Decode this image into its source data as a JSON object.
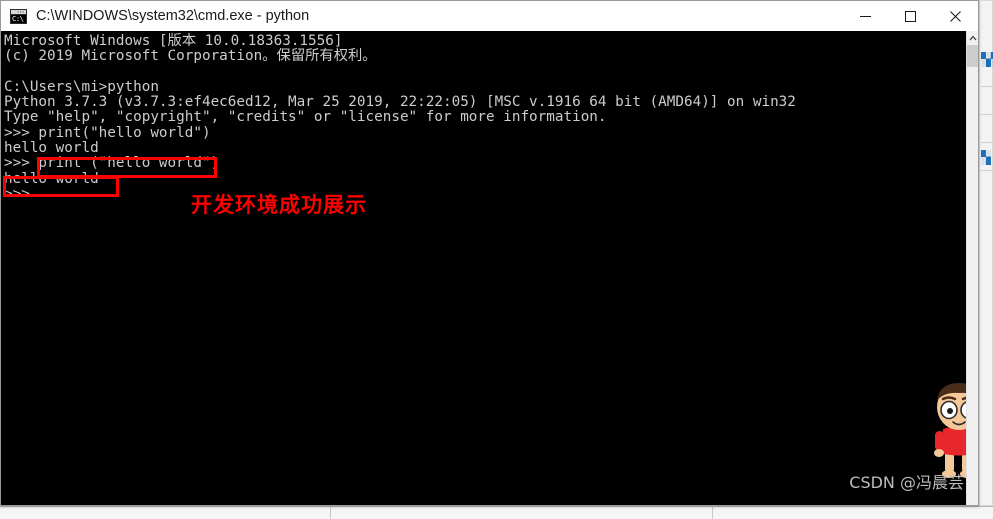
{
  "window": {
    "title": "C:\\WINDOWS\\system32\\cmd.exe - python",
    "icon_name": "cmd-exe-icon",
    "icon_text": "C:\\",
    "controls": {
      "minimize_label": "Minimize",
      "maximize_label": "Maximize",
      "close_label": "Close"
    }
  },
  "console": {
    "background_color": "#000000",
    "text_color": "#cccccc",
    "lines": [
      "Microsoft Windows [版本 10.0.18363.1556]",
      "(c) 2019 Microsoft Corporation。保留所有权利。",
      "",
      "C:\\Users\\mi>python",
      "Python 3.7.3 (v3.7.3:ef4ec6ed12, Mar 25 2019, 22:22:05) [MSC v.1916 64 bit (AMD64)] on win32",
      "Type \"help\", \"copyright\", \"credits\" or \"license\" for more information.",
      ">>> print(\"hello world\")",
      "hello world",
      ">>> print (\"hello world\")",
      "hello world",
      ">>> "
    ]
  },
  "scrollbar": {
    "up_arrow_name": "scroll-up-arrow",
    "thumb_name": "scroll-thumb"
  },
  "annotations": {
    "highlight_color": "#fd0000",
    "boxes": [
      {
        "name": "highlight-box-print-command",
        "label": "print (\"hello world\")"
      },
      {
        "name": "highlight-box-output",
        "label": "hello world"
      }
    ],
    "note": "开发环境成功展示"
  },
  "sticker": {
    "name": "crayon-shinchan-sticker",
    "shirt_color": "#e8272c",
    "skin_color": "#f5c89a",
    "hair_color": "#4a2c1a"
  },
  "watermark": {
    "text": "CSDN @冯晨芸",
    "color": "#bdbdbd"
  }
}
